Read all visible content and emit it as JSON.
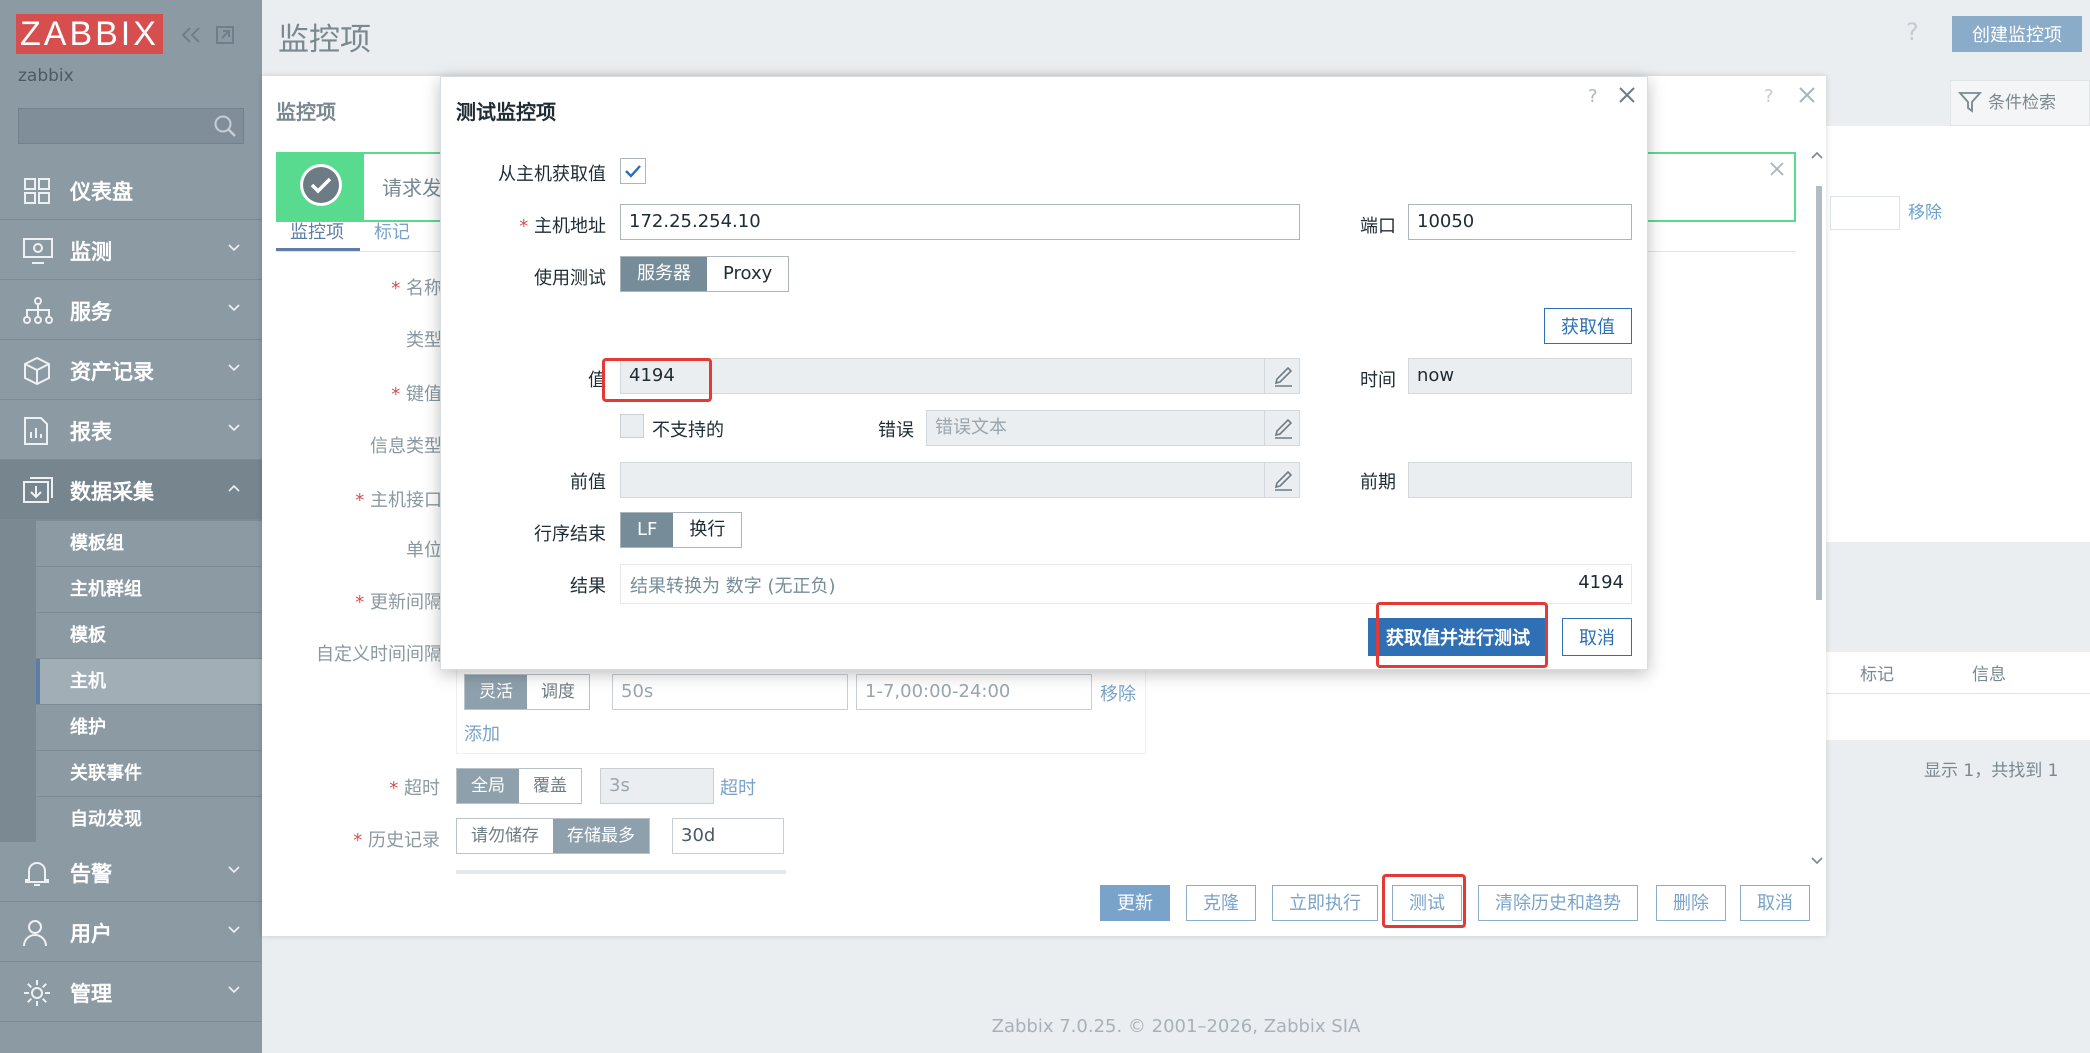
{
  "sidebar": {
    "logo": "ZABBIX",
    "server_name": "zabbix",
    "nav": [
      {
        "label": "仪表盘",
        "icon": "dashboard-icon"
      },
      {
        "label": "监测",
        "icon": "monitoring-icon"
      },
      {
        "label": "服务",
        "icon": "services-icon"
      },
      {
        "label": "资产记录",
        "icon": "inventory-icon"
      },
      {
        "label": "报表",
        "icon": "reports-icon"
      },
      {
        "label": "数据采集",
        "icon": "data-collection-icon"
      },
      {
        "label": "告警",
        "icon": "alerts-icon"
      },
      {
        "label": "用户",
        "icon": "users-icon"
      },
      {
        "label": "管理",
        "icon": "administration-icon"
      }
    ],
    "submenu": [
      "模板组",
      "主机群组",
      "模板",
      "主机",
      "维护",
      "关联事件",
      "自动发现"
    ]
  },
  "header": {
    "title": "监控项",
    "help": "?",
    "create_button": "创建监控项"
  },
  "item_dialog": {
    "title": "监控项",
    "help": "?",
    "success_message": "请求发",
    "tabs": [
      "监控项",
      "标记"
    ],
    "labels": {
      "name": "名称",
      "type": "类型",
      "key": "键值",
      "info_type": "信息类型",
      "interface": "主机接口",
      "units": "单位",
      "interval": "更新间隔",
      "custom_intervals": "自定义时间间隔",
      "timeout": "超时",
      "history": "历史记录"
    },
    "custom_interval": {
      "modes": [
        "灵活",
        "调度"
      ],
      "delay": "50s",
      "period": "1-7,00:00-24:00",
      "remove": "移除",
      "add": "添加"
    },
    "timeout": {
      "modes": [
        "全局",
        "覆盖"
      ],
      "value": "3s",
      "link": "超时"
    },
    "history": {
      "modes": [
        "请勿储存",
        "存储最多"
      ],
      "value": "30d"
    },
    "buttons": {
      "update": "更新",
      "clone": "克隆",
      "execute_now": "立即执行",
      "test": "测试",
      "clear_history": "清除历史和趋势",
      "delete": "删除",
      "cancel": "取消"
    }
  },
  "filter": {
    "label": "条件检索",
    "remove": "移除",
    "columns": [
      "标记",
      "信息"
    ],
    "footer": "显示 1，共找到 1"
  },
  "test_dialog": {
    "title": "测试监控项",
    "help": "?",
    "get_from_host_label": "从主机获取值",
    "get_from_host_checked": true,
    "host_address_label": "主机地址",
    "host_address": "172.25.254.10",
    "port_label": "端口",
    "port": "10050",
    "test_with_label": "使用测试",
    "test_with_options": [
      "服务器",
      "Proxy"
    ],
    "get_value_button": "获取值",
    "value_label": "值",
    "value": "4194",
    "time_label": "时间",
    "time": "now",
    "unsupported_label": "不支持的",
    "error_label": "错误",
    "error_placeholder": "错误文本",
    "prev_value_label": "前值",
    "prev_time_label": "前期",
    "eol_label": "行序结束",
    "eol_options": [
      "LF",
      "换行"
    ],
    "result_label": "结果",
    "result_text": "结果转换为 数字 (无正负)",
    "result_value": "4194",
    "get_and_test_button": "获取值并进行测试",
    "cancel_button": "取消"
  },
  "footer": "Zabbix 7.0.25. © 2001–2026, Zabbix SIA",
  "colors": {
    "accent": "#2f6fb3",
    "logo": "#d64e4e",
    "success": "#59db8f",
    "highlight": "#e53935",
    "sidebar": "#8c9aa3"
  }
}
